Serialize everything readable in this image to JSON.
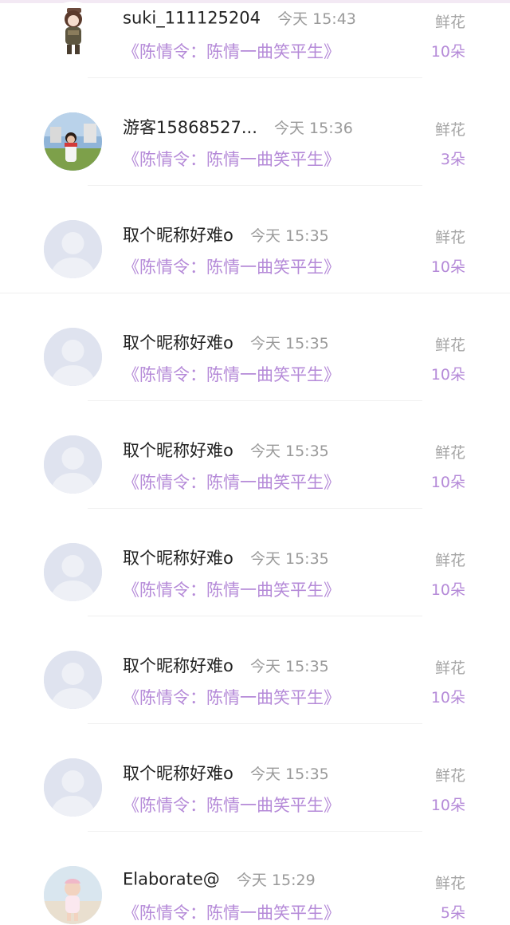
{
  "rows": [
    {
      "name": "suki_111125204",
      "time": "今天 15:43",
      "title": "《陈情令：陈情一曲笑平生》",
      "gift": "鲜花",
      "count": "10朵",
      "avatar": "anime-character-icon"
    },
    {
      "name": "游客15868527...",
      "time": "今天 15:36",
      "title": "《陈情令：陈情一曲笑平生》",
      "gift": "鲜花",
      "count": "3朵",
      "avatar": "photo-person-icon"
    },
    {
      "name": "取个昵称好难o",
      "time": "今天 15:35",
      "title": "《陈情令：陈情一曲笑平生》",
      "gift": "鲜花",
      "count": "10朵",
      "avatar": "default-avatar-icon"
    },
    {
      "name": "取个昵称好难o",
      "time": "今天 15:35",
      "title": "《陈情令：陈情一曲笑平生》",
      "gift": "鲜花",
      "count": "10朵",
      "avatar": "default-avatar-icon"
    },
    {
      "name": "取个昵称好难o",
      "time": "今天 15:35",
      "title": "《陈情令：陈情一曲笑平生》",
      "gift": "鲜花",
      "count": "10朵",
      "avatar": "default-avatar-icon"
    },
    {
      "name": "取个昵称好难o",
      "time": "今天 15:35",
      "title": "《陈情令：陈情一曲笑平生》",
      "gift": "鲜花",
      "count": "10朵",
      "avatar": "default-avatar-icon"
    },
    {
      "name": "取个昵称好难o",
      "time": "今天 15:35",
      "title": "《陈情令：陈情一曲笑平生》",
      "gift": "鲜花",
      "count": "10朵",
      "avatar": "default-avatar-icon"
    },
    {
      "name": "取个昵称好难o",
      "time": "今天 15:35",
      "title": "《陈情令：陈情一曲笑平生》",
      "gift": "鲜花",
      "count": "10朵",
      "avatar": "default-avatar-icon"
    },
    {
      "name": "Elaborate@",
      "time": "今天 15:29",
      "title": "《陈情令：陈情一曲笑平生》",
      "gift": "鲜花",
      "count": "5朵",
      "avatar": "photo-child-icon"
    }
  ],
  "colors": {
    "accent": "#b58ad8",
    "name": "#222222",
    "muted": "#a5a5a5",
    "default_avatar_bg": "#dfe3ef",
    "default_avatar_fg": "#bcc4e0"
  }
}
